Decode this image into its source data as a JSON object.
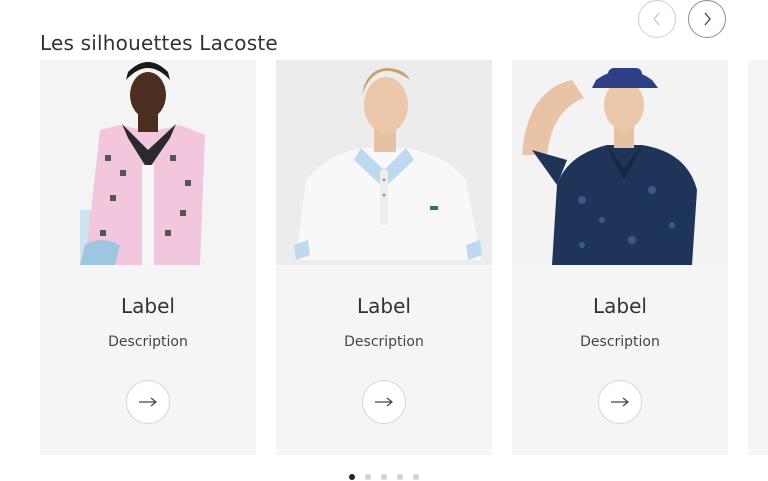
{
  "section": {
    "title": "Les silhouettes Lacoste"
  },
  "carousel": {
    "cards": [
      {
        "label": "Label",
        "description": "Description"
      },
      {
        "label": "Label",
        "description": "Description"
      },
      {
        "label": "Label",
        "description": "Description"
      }
    ],
    "page_dots": 5,
    "active_dot": 1
  },
  "icons": {
    "prev": "chevron-left-icon",
    "next": "chevron-right-icon",
    "card_cta": "arrow-right-icon"
  },
  "colors": {
    "card_background": "#f5f5f5",
    "active_dot": "#222222",
    "inactive_dot": "#d0d0d0"
  }
}
